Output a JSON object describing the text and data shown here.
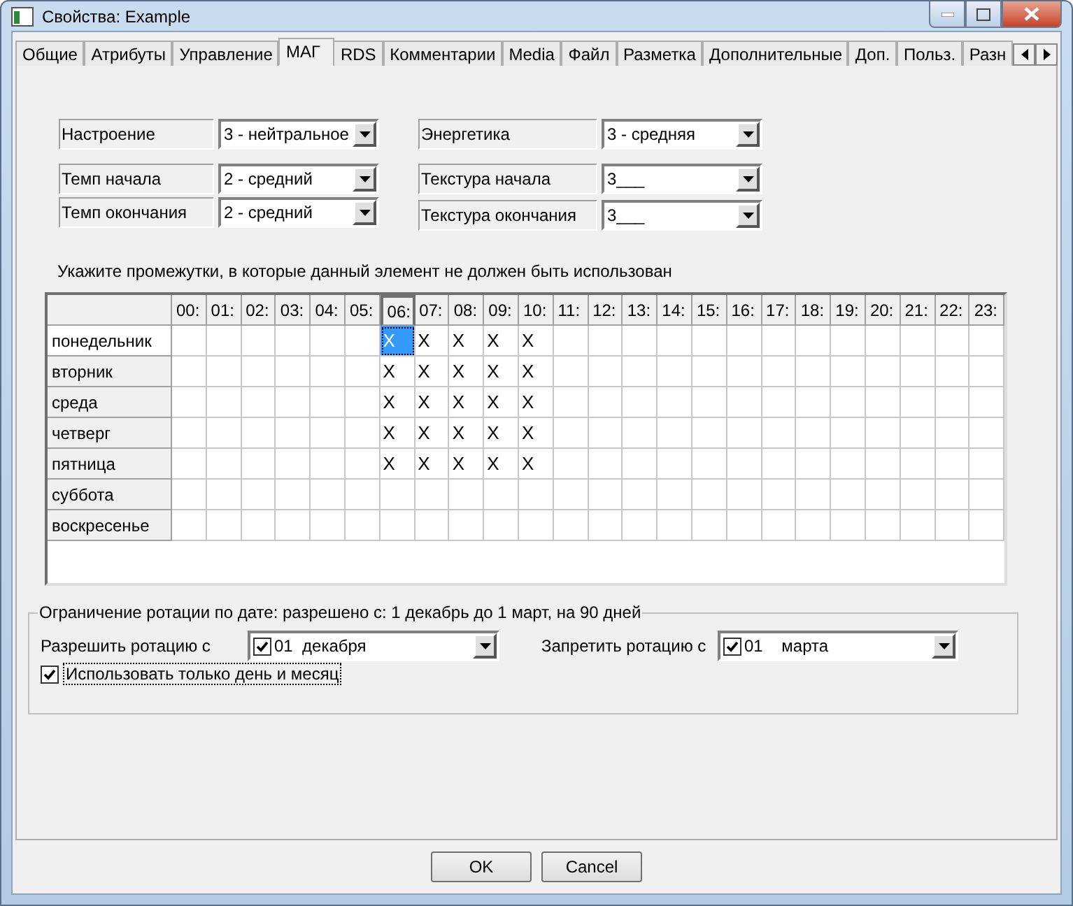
{
  "window": {
    "title": "Свойства: Example"
  },
  "tabs": [
    {
      "label": "Общие",
      "selected": false
    },
    {
      "label": "Атрибуты",
      "selected": false
    },
    {
      "label": "Управление",
      "selected": false
    },
    {
      "label": "МАГ",
      "selected": true
    },
    {
      "label": "RDS",
      "selected": false
    },
    {
      "label": "Комментарии",
      "selected": false
    },
    {
      "label": "Media",
      "selected": false
    },
    {
      "label": "Файл",
      "selected": false
    },
    {
      "label": "Разметка",
      "selected": false
    },
    {
      "label": "Дополнительные",
      "selected": false
    },
    {
      "label": "Доп.",
      "selected": false
    },
    {
      "label": "Польз.",
      "selected": false
    },
    {
      "label": "Разн",
      "selected": false
    }
  ],
  "fields_left": [
    {
      "label": "Настроение",
      "value": "3 - нейтральное"
    },
    {
      "label": "Темп начала",
      "value": "2 - средний"
    },
    {
      "label": "Темп окончания",
      "value": "2 - средний"
    }
  ],
  "fields_right": [
    {
      "label": "Энергетика",
      "value": "3 - средняя"
    },
    {
      "label": "Текстура начала",
      "value": "3___"
    },
    {
      "label": "Текстура окончания",
      "value": "3___"
    }
  ],
  "grid": {
    "caption": "Укажите промежутки, в которые данный элемент не должен быть использован",
    "columns": [
      {
        "label": "00:",
        "selected": false
      },
      {
        "label": "01:",
        "selected": false
      },
      {
        "label": "02:",
        "selected": false
      },
      {
        "label": "03:",
        "selected": false
      },
      {
        "label": "04:",
        "selected": false
      },
      {
        "label": "05:",
        "selected": false
      },
      {
        "label": "06:",
        "selected": true
      },
      {
        "label": "07:",
        "selected": false
      },
      {
        "label": "08:",
        "selected": false
      },
      {
        "label": "09:",
        "selected": false
      },
      {
        "label": "10:",
        "selected": false
      },
      {
        "label": "11:",
        "selected": false
      },
      {
        "label": "12:",
        "selected": false
      },
      {
        "label": "13:",
        "selected": false
      },
      {
        "label": "14:",
        "selected": false
      },
      {
        "label": "15:",
        "selected": false
      },
      {
        "label": "16:",
        "selected": false
      },
      {
        "label": "17:",
        "selected": false
      },
      {
        "label": "18:",
        "selected": false
      },
      {
        "label": "19:",
        "selected": false
      },
      {
        "label": "20:",
        "selected": false
      },
      {
        "label": "21:",
        "selected": false
      },
      {
        "label": "22:",
        "selected": false
      },
      {
        "label": "23:",
        "selected": false
      }
    ],
    "rows": [
      {
        "day": "понедельник",
        "selected": true,
        "cells": [
          null,
          null,
          null,
          null,
          null,
          null,
          "X",
          "X",
          "X",
          "X",
          "X",
          null,
          null,
          null,
          null,
          null,
          null,
          null,
          null,
          null,
          null,
          null,
          null,
          null
        ]
      },
      {
        "day": "вторник",
        "selected": false,
        "cells": [
          null,
          null,
          null,
          null,
          null,
          null,
          "X",
          "X",
          "X",
          "X",
          "X",
          null,
          null,
          null,
          null,
          null,
          null,
          null,
          null,
          null,
          null,
          null,
          null,
          null
        ]
      },
      {
        "day": "среда",
        "selected": false,
        "cells": [
          null,
          null,
          null,
          null,
          null,
          null,
          "X",
          "X",
          "X",
          "X",
          "X",
          null,
          null,
          null,
          null,
          null,
          null,
          null,
          null,
          null,
          null,
          null,
          null,
          null
        ]
      },
      {
        "day": "четверг",
        "selected": false,
        "cells": [
          null,
          null,
          null,
          null,
          null,
          null,
          "X",
          "X",
          "X",
          "X",
          "X",
          null,
          null,
          null,
          null,
          null,
          null,
          null,
          null,
          null,
          null,
          null,
          null,
          null
        ]
      },
      {
        "day": "пятница",
        "selected": false,
        "cells": [
          null,
          null,
          null,
          null,
          null,
          null,
          "X",
          "X",
          "X",
          "X",
          "X",
          null,
          null,
          null,
          null,
          null,
          null,
          null,
          null,
          null,
          null,
          null,
          null,
          null
        ]
      },
      {
        "day": "суббота",
        "selected": false,
        "cells": [
          null,
          null,
          null,
          null,
          null,
          null,
          null,
          null,
          null,
          null,
          null,
          null,
          null,
          null,
          null,
          null,
          null,
          null,
          null,
          null,
          null,
          null,
          null,
          null
        ]
      },
      {
        "day": "воскресенье",
        "selected": false,
        "cells": [
          null,
          null,
          null,
          null,
          null,
          null,
          null,
          null,
          null,
          null,
          null,
          null,
          null,
          null,
          null,
          null,
          null,
          null,
          null,
          null,
          null,
          null,
          null,
          null
        ]
      }
    ]
  },
  "rotation": {
    "legend": "Ограничение ротации по дате: разрешено с: 1 декабрь до 1 март, на 90 дней",
    "allow": {
      "label": "Разрешить ротацию с",
      "checked": true,
      "value": "01  декабря"
    },
    "deny": {
      "label": "Запретить ротацию с",
      "checked": true,
      "value": "01    марта"
    },
    "day_month_only": {
      "label": "Использовать только день и месяц",
      "checked": true
    }
  },
  "buttons": [
    "OK",
    "Cancel"
  ]
}
